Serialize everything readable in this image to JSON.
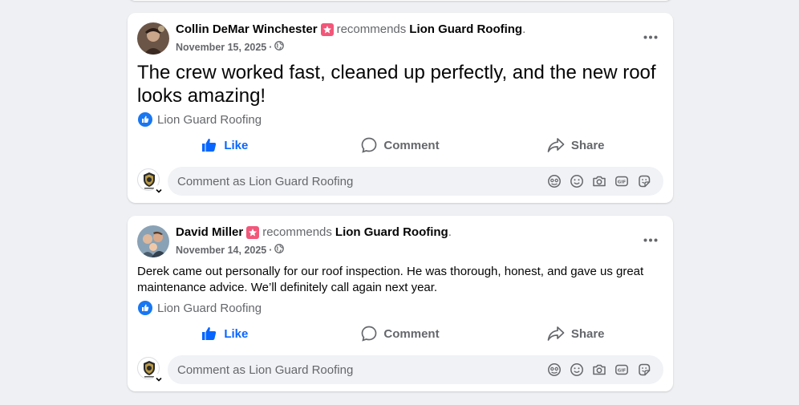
{
  "colors": {
    "accent": "#0866ff",
    "recommend_badge": "#f2577a",
    "muted": "#65676b"
  },
  "posts": [
    {
      "author": "Collin DeMar Winchester",
      "recommends_word": "recommends",
      "page": "Lion Guard Roofing",
      "period": ".",
      "date": "November 15, 2025",
      "separator": "·",
      "privacy_icon": "globe-icon",
      "text": "The crew worked fast, cleaned up perfectly, and the new roof looks amazing!",
      "recommended_page": "Lion Guard Roofing",
      "actions": {
        "like": "Like",
        "comment": "Comment",
        "share": "Share"
      },
      "comment_placeholder": "Comment as Lion Guard Roofing"
    },
    {
      "author": "David Miller",
      "recommends_word": "recommends",
      "page": "Lion Guard Roofing",
      "period": ".",
      "date": "November 14, 2025",
      "separator": "·",
      "privacy_icon": "globe-icon",
      "text": "Derek came out personally for our roof inspection. He was thorough, honest, and gave us great maintenance advice. We’ll definitely call again next year.",
      "recommended_page": "Lion Guard Roofing",
      "actions": {
        "like": "Like",
        "comment": "Comment",
        "share": "Share"
      },
      "comment_placeholder": "Comment as Lion Guard Roofing"
    }
  ],
  "comment_tools": [
    "avatar-sticker-icon",
    "emoji-icon",
    "camera-icon",
    "gif-icon",
    "sticker-icon"
  ]
}
